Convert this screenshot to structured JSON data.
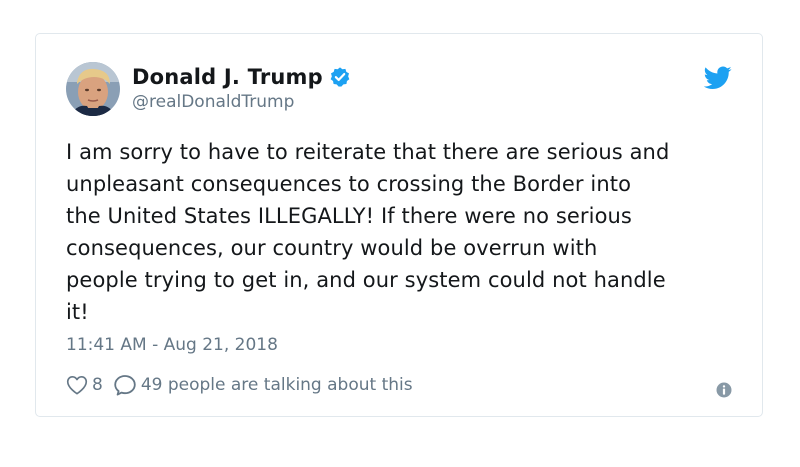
{
  "tweet": {
    "author_name": "Donald J. Trump",
    "handle": "@realDonaldTrump",
    "text": "I am sorry to have to reiterate that there are serious and\nunpleasant consequences to crossing the Border into\nthe United States ILLEGALLY! If there were no serious\nconsequences, our country would be overrun with\npeople trying to get in, and our system could not handle\nit!",
    "timestamp": "11:41 AM - Aug 21, 2018",
    "like_count": "8",
    "talking_text": "49 people are talking about this"
  },
  "icons": {
    "verified": "verified-badge-icon",
    "brand": "twitter-bird-icon",
    "like": "heart-icon",
    "reply": "speech-bubble-icon",
    "info": "info-icon"
  },
  "colors": {
    "brand_blue": "#1da1f2",
    "secondary_text": "#657786",
    "primary_text": "#14171a",
    "border": "#e1e8ed"
  }
}
